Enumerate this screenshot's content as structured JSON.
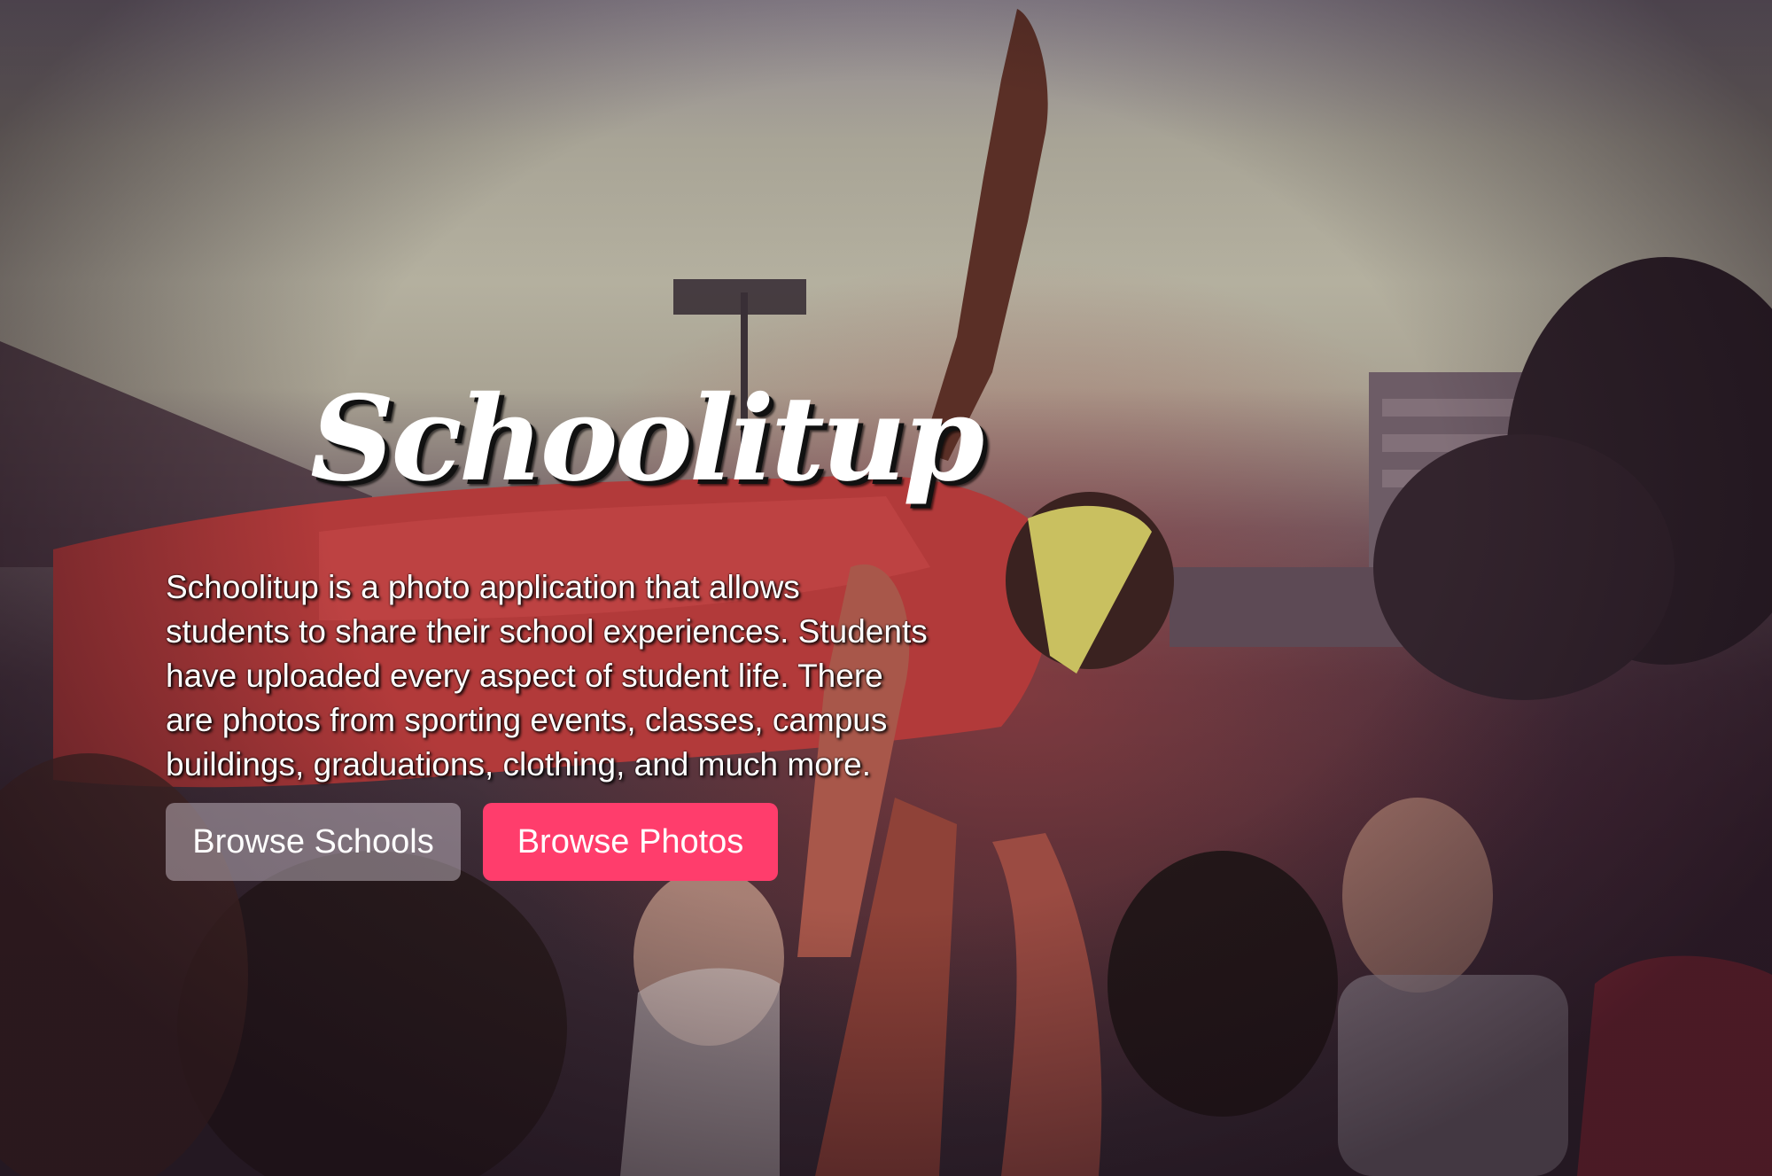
{
  "hero": {
    "logo_text": "Schoolitup",
    "description": "Schoolitup is a photo application that allows students to share their school experiences. Students have uploaded every aspect of student life. There are photos from sporting events, classes, campus buildings, graduations, clothing, and much more.",
    "background_image": "crowd-surfing-students-photo"
  },
  "buttons": {
    "browse_schools_label": "Browse Schools",
    "browse_photos_label": "Browse Photos"
  },
  "colors": {
    "primary_button": "#ff3d6c",
    "secondary_button": "rgba(215,205,215,0.45)",
    "text": "#ffffff"
  }
}
